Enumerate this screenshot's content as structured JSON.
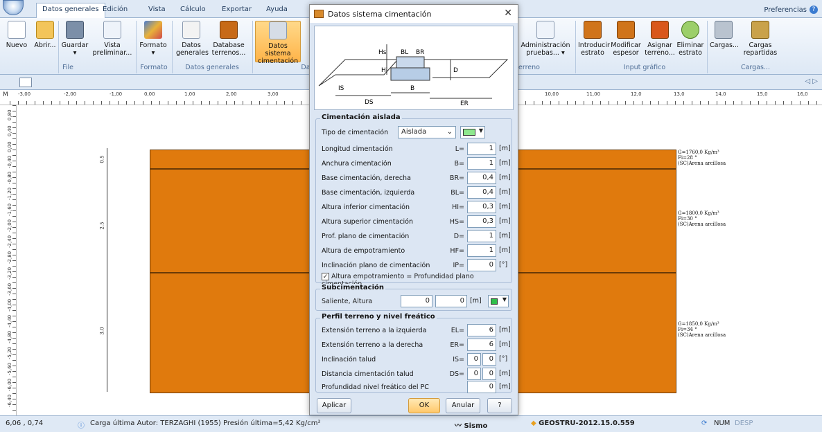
{
  "tabs": [
    "Datos generales",
    "Edición",
    "Vista",
    "Cálculo",
    "Exportar",
    "Ayuda"
  ],
  "preferences": "Preferencias",
  "ribbon": {
    "buttons": [
      "Nuevo",
      "Abrir...",
      "Guardar",
      "Vista preliminar...",
      "Formato",
      "Datos generales",
      "Database terrenos...",
      "Datos sistema cimentación",
      "Administración pruebas...",
      "Introducir estrato",
      "Modificar espesor",
      "Asignar terreno...",
      "Eliminar estrato",
      "Cargas...",
      "Cargas repartidas"
    ],
    "groups": [
      "File",
      "Formato",
      "Datos generales",
      "Da",
      "erreno",
      "Input gráfico",
      "Cargas..."
    ]
  },
  "ruler_h": [
    "-3,00",
    "-2,00",
    "-1,00",
    "0,00",
    "1,00",
    "2,00",
    "3,00",
    "10,00",
    "11,00",
    "12,0",
    "13,0",
    "14,0",
    "15,0",
    "16,0"
  ],
  "ruler_v": [
    "0,80",
    "0,40",
    "0,00",
    "-0,40",
    "-0,80",
    "-1,20",
    "-1,60",
    "-2,00",
    "-2,40",
    "-2,80",
    "-3,20",
    "-3,60",
    "-4,00",
    "-4,40",
    "-4,80",
    "-5,20",
    "-5,60",
    "-6,00",
    "-6,40"
  ],
  "ruler_corner": "M",
  "layers": [
    {
      "thick": "0.5",
      "g": "G=1760,0 Kg/m³",
      "fi": "Fi=28 °",
      "type": "(SC)Arena arcillosa"
    },
    {
      "thick": "2.5",
      "g": "G=1800,0 Kg/m³",
      "fi": "Fi=30 °",
      "type": "(SC)Arena arcillosa"
    },
    {
      "thick": "3.0",
      "g": "G=1850,0 Kg/m³",
      "fi": "Fi=34 °",
      "type": "(SC)Arena arcillosa"
    }
  ],
  "dialog": {
    "title": "Datos sistema cimentación",
    "close": "✕",
    "diagram_labels": [
      "Hs",
      "Hi",
      "BL",
      "BR",
      "D",
      "IS",
      "DS",
      "B",
      "ER"
    ],
    "section1": "Cimentación aislada",
    "tipo_label": "Tipo de cimentación",
    "tipo_value": "Aislada",
    "rows": [
      {
        "label": "Longitud cimentación",
        "sym": "L=",
        "val": "1",
        "unit": "[m]"
      },
      {
        "label": "Anchura cimentación",
        "sym": "B=",
        "val": "1",
        "unit": "[m]"
      },
      {
        "label": "Base cimentación, derecha",
        "sym": "BR=",
        "val": "0,4",
        "unit": "[m]"
      },
      {
        "label": "Base cimentación, izquierda",
        "sym": "BL=",
        "val": "0,4",
        "unit": "[m]"
      },
      {
        "label": "Altura inferior cimentación",
        "sym": "HI=",
        "val": "0,3",
        "unit": "[m]"
      },
      {
        "label": "Altura superior cimentación",
        "sym": "HS=",
        "val": "0,3",
        "unit": "[m]"
      },
      {
        "label": "Prof. plano de cimentación",
        "sym": "D=",
        "val": "1",
        "unit": "[m]"
      },
      {
        "label": "Altura de empotramiento",
        "sym": "HF=",
        "val": "1",
        "unit": "[m]"
      },
      {
        "label": "Inclinación plano de cimentación",
        "sym": "IP=",
        "val": "0",
        "unit": "[°]"
      }
    ],
    "checkbox": "Altura empotramiento = Profundidad plano cimentación",
    "section2": "Subcimentación",
    "sub_label": "Saliente, Altura",
    "sub_v1": "0",
    "sub_v2": "0",
    "sub_unit": "[m]",
    "section3": "Perfil terreno y nivel freático",
    "rows3": [
      {
        "label": "Extensión terreno a la izquierda",
        "sym": "EL=",
        "val": "6",
        "unit": "[m]"
      },
      {
        "label": "Extensión terreno a la derecha",
        "sym": "ER=",
        "val": "6",
        "unit": "[m]"
      }
    ],
    "talud_label": "Inclinación talud",
    "talud_sym": "IS=",
    "talud_v1": "0",
    "talud_v2": "0",
    "talud_unit": "[°]",
    "dist_label": "Distancia cimentación talud",
    "dist_sym": "DS=",
    "dist_v1": "0",
    "dist_v2": "0",
    "dist_unit": "[m]",
    "freat_label": "Profundidad nivel freático del PC",
    "freat_val": "0",
    "freat_unit": "[m]",
    "btn_apply": "Aplicar",
    "btn_ok": "OK",
    "btn_cancel": "Anular",
    "btn_help": "?"
  },
  "status": {
    "coords": "6,06 , 0,74",
    "message": "Carga última Autor: TERZAGHI (1955) Presión última=5,42 Kg/cm²",
    "sismo": "Sismo",
    "version": "GEOSTRU-2012.15.0.559",
    "num": "NUM",
    "desp": "DESP"
  },
  "colors": {
    "layer": "#e07a0d",
    "ribbon": "#dde8f5",
    "selected": "#ffb449",
    "green_swatch": "#8ee88e"
  }
}
